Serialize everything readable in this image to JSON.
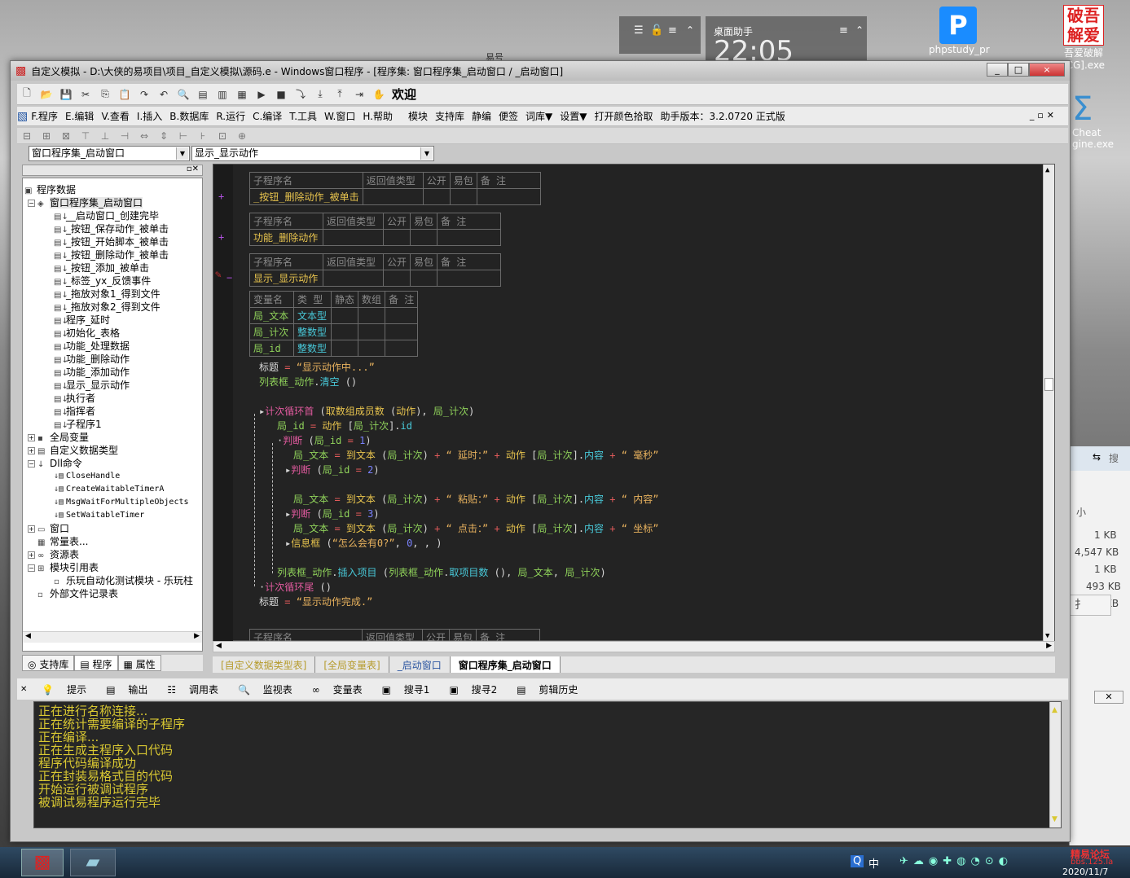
{
  "desktop": {
    "tile1_title": "桌面助手",
    "tile1_clock": "22:05",
    "tile1_label": "易号",
    "icon1_label": "phpstudy_pr",
    "icon2_label": "吾爱破解",
    "icon2_sub": "[CG].exe",
    "icon3_label": "Cheat",
    "icon3_sub": "gine.exe",
    "sizes": [
      "小",
      "1 KB",
      "4,547 KB",
      "1 KB",
      "493 KB",
      "KB"
    ],
    "ime": "中 ♪ 扌",
    "search_glyph": "搜"
  },
  "window": {
    "title": "自定义模拟 - D:\\大侠的易项目\\项目_自定义模拟\\源码.e - Windows窗口程序 - [程序集: 窗口程序集_启动窗口 / _启动窗口]",
    "controls": [
      "_",
      "□",
      "×"
    ]
  },
  "menu": {
    "items": [
      "F.程序",
      "E.编辑",
      "V.查看",
      "I.插入",
      "B.数据库",
      "R.运行",
      "C.编译",
      "T.工具",
      "W.窗口",
      "H.帮助"
    ],
    "extras": [
      "模块",
      "支持库",
      "静编",
      "便签",
      "词库▼",
      "设置▼",
      "打开颜色拾取"
    ],
    "version": "助手版本：3.2.0720 正式版",
    "welcome": "欢迎"
  },
  "combos": {
    "left": "窗口程序集_启动窗口",
    "right": "显示_显示动作"
  },
  "tree": {
    "root": "程序数据",
    "group": "窗口程序集_启动窗口",
    "subs": [
      "__启动窗口_创建完毕",
      "_按钮_保存动作_被单击",
      "_按钮_开始脚本_被单击",
      "_按钮_删除动作_被单击",
      "_按钮_添加_被单击",
      "_标签_yx_反馈事件",
      "_拖放对象1_得到文件",
      "_拖放对象2_得到文件",
      "程序_延时",
      "初始化_表格",
      "功能_处理数据",
      "功能_删除动作",
      "功能_添加动作",
      "显示_显示动作",
      "执行者",
      "指挥者",
      "子程序1"
    ],
    "global": "全局变量",
    "custom": "自定义数据类型",
    "dll": "Dll命令",
    "dlls": [
      "CloseHandle",
      "CreateWaitableTimerA",
      "MsgWaitForMultipleObjects",
      "SetWaitableTimer"
    ],
    "window": "窗口",
    "const": "常量表...",
    "res": "资源表",
    "modref": "模块引用表",
    "module": "乐玩自动化测试模块 - 乐玩柱",
    "extfile": "外部文件记录表"
  },
  "left_tabs": [
    "支持库",
    "程序",
    "属性"
  ],
  "sub_headers": [
    "子程序名",
    "返回值类型",
    "公开",
    "易包",
    "备 注"
  ],
  "subs": [
    "_按钮_删除动作_被单击",
    "功能_删除动作",
    "显示_显示动作"
  ],
  "var_headers": [
    "变量名",
    "类 型",
    "静态",
    "数组",
    "备 注"
  ],
  "vars": [
    {
      "name": "局_文本",
      "type": "文本型"
    },
    {
      "name": "局_计次",
      "type": "整数型"
    },
    {
      "name": "局_id",
      "type": "整数型"
    }
  ],
  "code": {
    "l1_a": "标题",
    "l1_b": " = ",
    "l1_c": "“显示动作中...”",
    "l2_a": "列表框_动作",
    "l2_b": ".",
    "l2_c": "清空",
    "l2_d": " ()",
    "l3_kw": "计次循环首",
    "l3_a": " (",
    "l3_fn": "取数组成员数",
    "l3_b": " (",
    "l3_v": "动作",
    "l3_c": "), ",
    "l3_v2": "局_计次",
    "l3_d": ")",
    "l4_v": "局_id",
    "l4_eq": " = ",
    "l4_v2": "动作",
    "l4_b": " [",
    "l4_v3": "局_计次",
    "l4_c": "].",
    "l4_p": "id",
    "l5_kw": "判断",
    "l5_a": " (",
    "l5_v": "局_id",
    "l5_op": " = ",
    "l5_n": "1",
    "l5_b": ")",
    "l6_v": "局_文本",
    "l6_eq": " = ",
    "l6_fn": "到文本",
    "l6_a": " (",
    "l6_v2": "局_计次",
    "l6_b": ") ",
    "l6_p1": "+",
    "l6_s1": " “ 延时：” ",
    "l6_p2": "+",
    "l6_v3": " 动作",
    "l6_c": " [",
    "l6_v4": "局_计次",
    "l6_d": "].",
    "l6_pr": "内容",
    "l6_p3": " + ",
    "l6_s2": "“ 毫秒”",
    "l7_kw": "判断",
    "l7_a": " (",
    "l7_v": "局_id",
    "l7_op": " = ",
    "l7_n": "2",
    "l7_b": ")",
    "l8_v": "局_文本",
    "l8_eq": " = ",
    "l8_fn": "到文本",
    "l8_a": " (",
    "l8_v2": "局_计次",
    "l8_b": ") ",
    "l8_p1": "+",
    "l8_s1": " “ 粘贴：” ",
    "l8_p2": "+",
    "l8_v3": " 动作",
    "l8_c": " [",
    "l8_v4": "局_计次",
    "l8_d": "].",
    "l8_pr": "内容",
    "l8_p3": " + ",
    "l8_s2": "“ 内容”",
    "l9_kw": "判断",
    "l9_a": " (",
    "l9_v": "局_id",
    "l9_op": " = ",
    "l9_n": "3",
    "l9_b": ")",
    "l10_v": "局_文本",
    "l10_eq": " = ",
    "l10_fn": "到文本",
    "l10_a": " (",
    "l10_v2": "局_计次",
    "l10_b": ") ",
    "l10_p1": "+",
    "l10_s1": " “ 点击：” ",
    "l10_p2": "+",
    "l10_v3": " 动作",
    "l10_c": " [",
    "l10_v4": "局_计次",
    "l10_d": "].",
    "l10_pr": "内容",
    "l10_p3": " + ",
    "l10_s2": "“ 坐标”",
    "l11_fn": "信息框",
    "l11_a": " (",
    "l11_s": "“怎么会有0?”",
    "l11_b": ", ",
    "l11_n": "0",
    "l11_c": ", , )",
    "l12_v": "列表框_动作",
    "l12_a": ".",
    "l12_p": "插入项目",
    "l12_b": " (",
    "l12_v2": "列表框_动作",
    "l12_c": ".",
    "l12_p2": "取项目数",
    "l12_d": " (), ",
    "l12_v3": "局_文本",
    "l12_e": ", ",
    "l12_v4": "局_计次",
    "l12_f": ")",
    "l13_kw": "计次循环尾",
    "l13_a": " ()",
    "l14_a": "标题",
    "l14_b": " = ",
    "l14_c": "“显示动作完成.”"
  },
  "editor_tabs": [
    "[自定义数据类型表]",
    "[全局变量表]",
    "_启动窗口",
    "窗口程序集_启动窗口"
  ],
  "output_tabs": [
    "提示",
    "输出",
    "调用表",
    "监视表",
    "变量表",
    "搜寻1",
    "搜寻2",
    "剪辑历史"
  ],
  "output_lines": [
    "正在进行名称连接...",
    "正在统计需要编译的子程序",
    "正在编译...",
    "正在生成主程序入口代码",
    "程序代码编译成功",
    "正在封装易格式目的代码",
    "开始运行被调试程序",
    "被调试易程序运行完毕"
  ],
  "taskbar": {
    "date": "2020/11/7",
    "forum": "精易论坛",
    "forum_url": "bbs.125.la",
    "ime": "中"
  }
}
